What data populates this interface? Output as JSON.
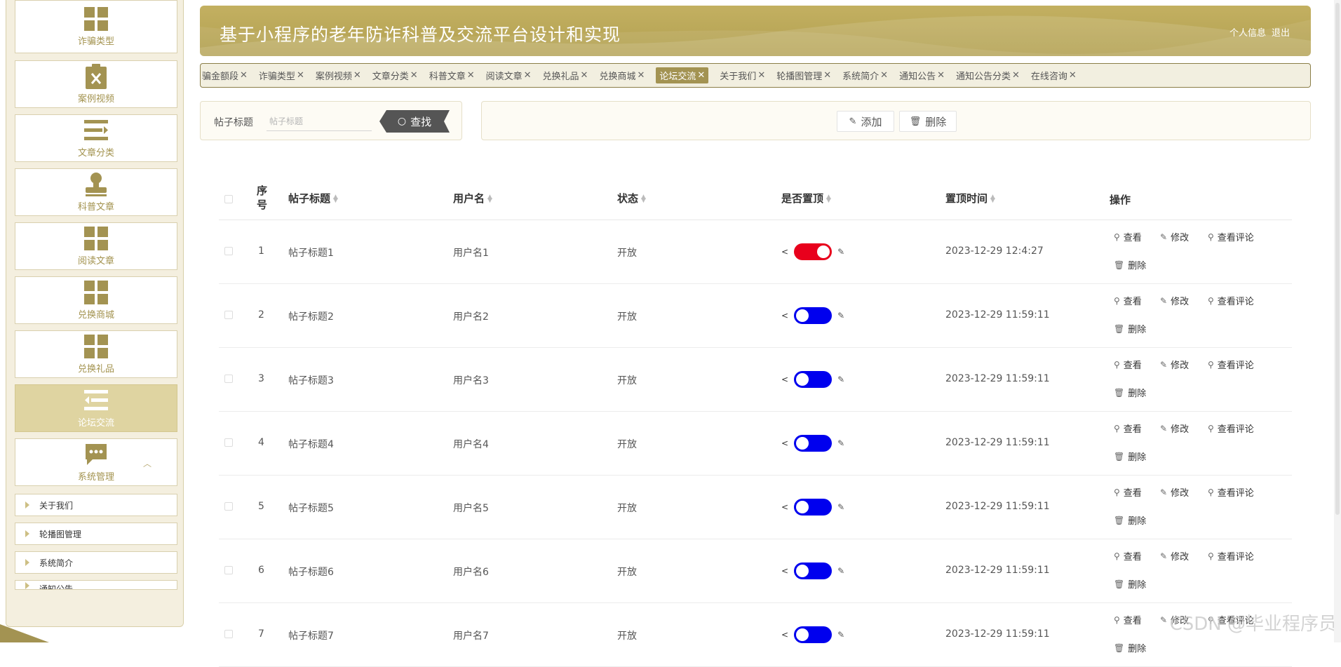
{
  "sidebar": {
    "items": [
      {
        "label": "诈骗类型",
        "icon": "grid-icon"
      },
      {
        "label": "案例视频",
        "icon": "clipboard-x-icon"
      },
      {
        "label": "文章分类",
        "icon": "list-icon"
      },
      {
        "label": "科普文章",
        "icon": "stamp-icon"
      },
      {
        "label": "阅读文章",
        "icon": "grid-icon"
      },
      {
        "label": "兑换商城",
        "icon": "grid-icon"
      },
      {
        "label": "兑换礼品",
        "icon": "grid-icon"
      },
      {
        "label": "论坛交流",
        "icon": "menu-indent-icon"
      },
      {
        "label": "系统管理",
        "icon": "chat-icon"
      }
    ],
    "sub_items": [
      {
        "label": "关于我们"
      },
      {
        "label": "轮播图管理"
      },
      {
        "label": "系统简介"
      },
      {
        "label": "通知公告"
      }
    ]
  },
  "header": {
    "title": "基于小程序的老年防诈科普及交流平台设计和实现",
    "profile_link": "个人信息",
    "logout_link": "退出"
  },
  "tabs": [
    {
      "label": "骗金额段"
    },
    {
      "label": "诈骗类型"
    },
    {
      "label": "案例视频"
    },
    {
      "label": "文章分类"
    },
    {
      "label": "科普文章"
    },
    {
      "label": "阅读文章"
    },
    {
      "label": "兑换礼品"
    },
    {
      "label": "兑换商城"
    },
    {
      "label": "论坛交流",
      "active": true
    },
    {
      "label": "关于我们"
    },
    {
      "label": "轮播图管理"
    },
    {
      "label": "系统简介"
    },
    {
      "label": "通知公告"
    },
    {
      "label": "通知公告分类"
    },
    {
      "label": "在线咨询"
    }
  ],
  "search": {
    "label": "帖子标题",
    "placeholder": "帖子标题",
    "button": "查找"
  },
  "actions": {
    "add": "添加",
    "delete": "删除"
  },
  "table": {
    "headers": {
      "index": "序号",
      "title": "帖子标题",
      "username": "用户名",
      "status": "状态",
      "pinned": "是否置顶",
      "pin_time": "置顶时间",
      "ops": "操作"
    },
    "op_labels": {
      "view": "查看",
      "edit": "修改",
      "view_comments": "查看评论",
      "delete": "删除"
    },
    "rows": [
      {
        "index": "1",
        "title": "帖子标题1",
        "username": "用户名1",
        "status": "开放",
        "pinned": true,
        "pin_time": "2023-12-29 12:4:27"
      },
      {
        "index": "2",
        "title": "帖子标题2",
        "username": "用户名2",
        "status": "开放",
        "pinned": false,
        "pin_time": "2023-12-29 11:59:11"
      },
      {
        "index": "3",
        "title": "帖子标题3",
        "username": "用户名3",
        "status": "开放",
        "pinned": false,
        "pin_time": "2023-12-29 11:59:11"
      },
      {
        "index": "4",
        "title": "帖子标题4",
        "username": "用户名4",
        "status": "开放",
        "pinned": false,
        "pin_time": "2023-12-29 11:59:11"
      },
      {
        "index": "5",
        "title": "帖子标题5",
        "username": "用户名5",
        "status": "开放",
        "pinned": false,
        "pin_time": "2023-12-29 11:59:11"
      },
      {
        "index": "6",
        "title": "帖子标题6",
        "username": "用户名6",
        "status": "开放",
        "pinned": false,
        "pin_time": "2023-12-29 11:59:11"
      },
      {
        "index": "7",
        "title": "帖子标题7",
        "username": "用户名7",
        "status": "开放",
        "pinned": false,
        "pin_time": "2023-12-29 11:59:11"
      }
    ]
  },
  "watermark": "CSDN @毕业程序员",
  "colors": {
    "accent": "#a39352",
    "header": "#b8a656",
    "toggle_on": "#e8001c",
    "toggle_off": "#0000ee"
  }
}
